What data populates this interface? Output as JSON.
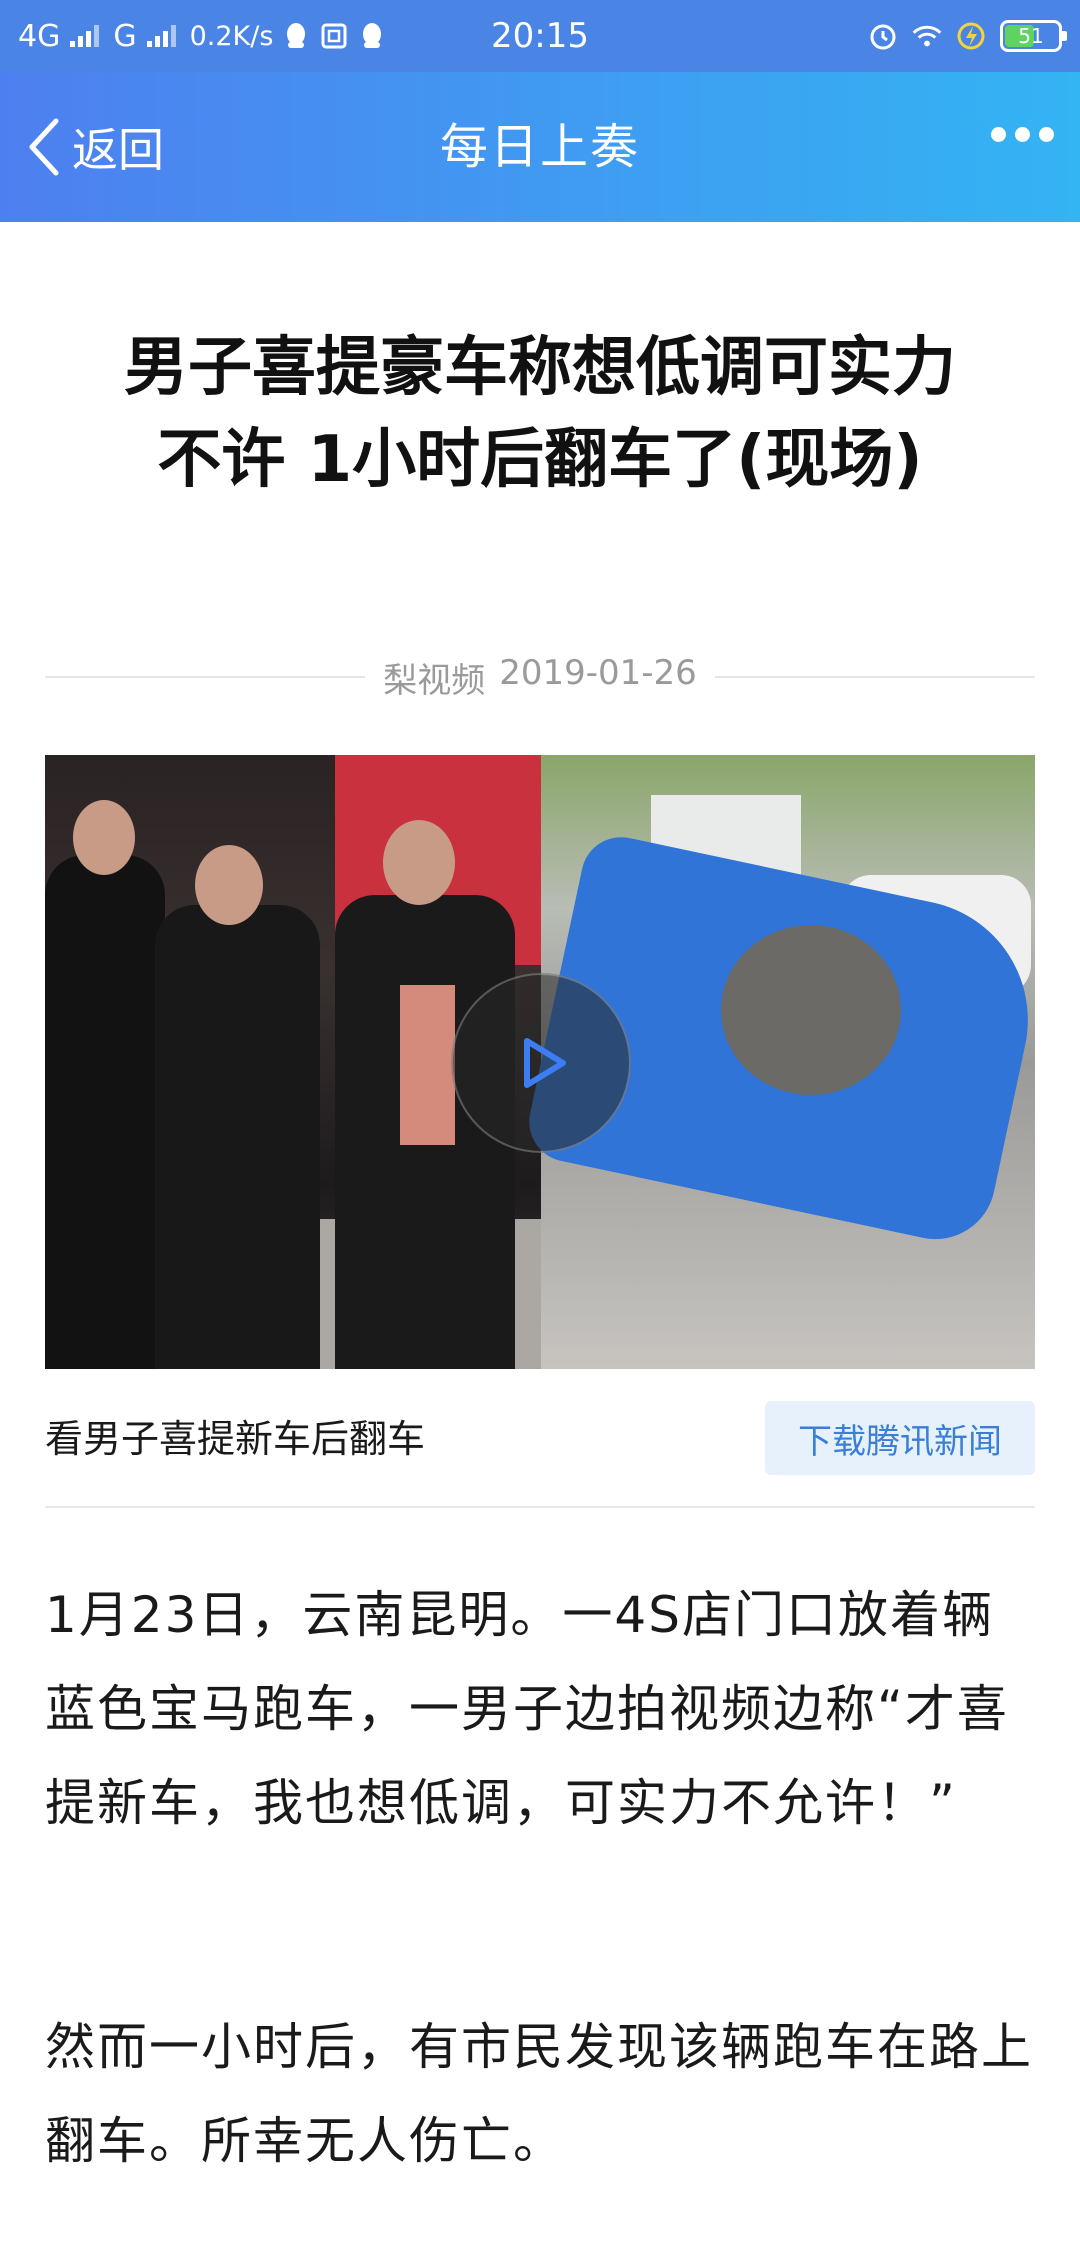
{
  "status_bar": {
    "network_1": "4G",
    "network_2": "G",
    "speed": "0.2K/s",
    "time": "20:15",
    "battery": "51"
  },
  "nav": {
    "back_label": "返回",
    "title": "每日上奏"
  },
  "article": {
    "title": "男子喜提豪车称想低调可实力不许 1小时后翻车了(现场)",
    "source": "梨视频",
    "date": "2019-01-26",
    "video_caption": "看男子喜提新车后翻车",
    "download_label": "下载腾讯新闻",
    "paragraphs": [
      "1月23日，云南昆明。一4S店门口放着辆蓝色宝马跑车，一男子边拍视频边称“才喜提新车，我也想低调，可实力不允许！”",
      "然而一小时后，有市民发现该辆跑车在路上翻车。所幸无人伤亡。"
    ]
  },
  "colors": {
    "nav_start": "#4e7ff0",
    "nav_end": "#33b4f3",
    "accent": "#3a7fd5"
  }
}
